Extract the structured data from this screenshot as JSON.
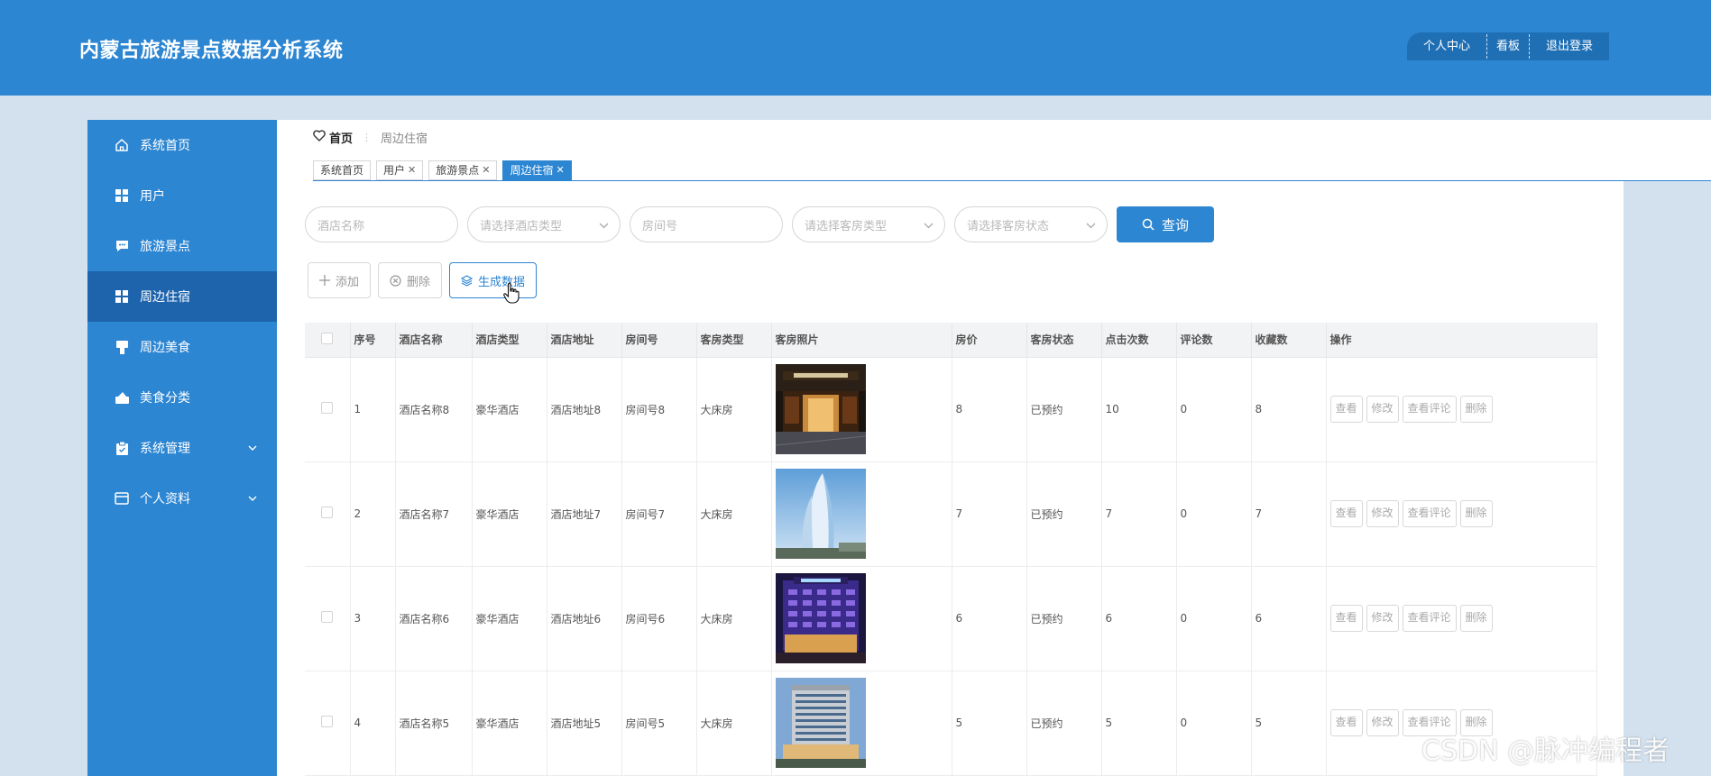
{
  "app": {
    "title": "内蒙古旅游景点数据分析系统"
  },
  "header": {
    "nav": [
      "个人中心",
      "看板",
      "退出登录"
    ]
  },
  "sidebar": {
    "items": [
      {
        "label": "系统首页",
        "icon": "home-icon"
      },
      {
        "label": "用户",
        "icon": "grid-icon"
      },
      {
        "label": "旅游景点",
        "icon": "chat-icon"
      },
      {
        "label": "周边住宿",
        "icon": "grid-icon",
        "active": true
      },
      {
        "label": "周边美食",
        "icon": "food-icon"
      },
      {
        "label": "美食分类",
        "icon": "category-icon"
      },
      {
        "label": "系统管理",
        "icon": "clipboard-icon",
        "expandable": true
      },
      {
        "label": "个人资料",
        "icon": "wallet-icon",
        "expandable": true
      }
    ]
  },
  "breadcrumb": {
    "home": "首页",
    "current": "周边住宿"
  },
  "tabs": [
    {
      "label": "系统首页",
      "closable": false
    },
    {
      "label": "用户",
      "closable": true
    },
    {
      "label": "旅游景点",
      "closable": true
    },
    {
      "label": "周边住宿",
      "closable": true,
      "active": true
    }
  ],
  "search": {
    "hotel_name_placeholder": "酒店名称",
    "hotel_type_placeholder": "请选择酒店类型",
    "room_no_placeholder": "房间号",
    "room_type_placeholder": "请选择客房类型",
    "room_status_placeholder": "请选择客房状态",
    "button": "查询"
  },
  "actions": {
    "add": "添加",
    "delete": "删除",
    "generate": "生成数据"
  },
  "table": {
    "columns": [
      "序号",
      "酒店名称",
      "酒店类型",
      "酒店地址",
      "房间号",
      "客房类型",
      "客房照片",
      "房价",
      "客房状态",
      "点击次数",
      "评论数",
      "收藏数",
      "操作"
    ],
    "rows": [
      {
        "index": "1",
        "name": "酒店名称8",
        "type": "豪华酒店",
        "address": "酒店地址8",
        "room_no": "房间号8",
        "room_type": "大床房",
        "photo": "hotel-night-entrance",
        "price": "8",
        "status": "已预约",
        "clicks": "10",
        "comments": "0",
        "favorites": "8"
      },
      {
        "index": "2",
        "name": "酒店名称7",
        "type": "豪华酒店",
        "address": "酒店地址7",
        "room_no": "房间号7",
        "room_type": "大床房",
        "photo": "glass-tower",
        "price": "7",
        "status": "已预约",
        "clicks": "7",
        "comments": "0",
        "favorites": "7"
      },
      {
        "index": "3",
        "name": "酒店名称6",
        "type": "豪华酒店",
        "address": "酒店地址6",
        "room_no": "房间号6",
        "room_type": "大床房",
        "photo": "hotel-purple-night",
        "price": "6",
        "status": "已预约",
        "clicks": "6",
        "comments": "0",
        "favorites": "6"
      },
      {
        "index": "4",
        "name": "酒店名称5",
        "type": "豪华酒店",
        "address": "酒店地址5",
        "room_no": "房间号5",
        "room_type": "大床房",
        "photo": "hotel-building-day",
        "price": "5",
        "status": "已预约",
        "clicks": "5",
        "comments": "0",
        "favorites": "5"
      }
    ],
    "ops": [
      "查看",
      "修改",
      "查看评论",
      "删除"
    ]
  },
  "watermark": "CSDN @脉冲编程者",
  "colors": {
    "primary": "#2d86d2",
    "sidebar_active": "#1e64ad",
    "background": "#d3e1ef"
  }
}
